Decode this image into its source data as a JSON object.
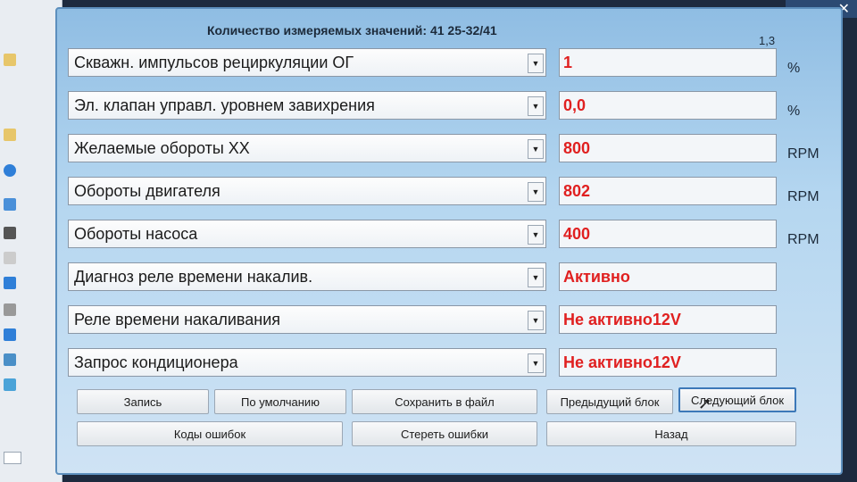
{
  "header": {
    "title": "Количество измеряемых значений: 41  25-32/41",
    "corner_value": "1,3"
  },
  "rows": [
    {
      "label": "Скважн. импульсов рециркуляции ОГ",
      "value": "1",
      "unit": "%"
    },
    {
      "label": "Эл. клапан управл. уровнем завихрения",
      "value": "0,0",
      "unit": "%"
    },
    {
      "label": "Желаемые обороты ХХ",
      "value": "800",
      "unit": "RPM"
    },
    {
      "label": "Обороты двигателя",
      "value": "802",
      "unit": "RPM"
    },
    {
      "label": "Обороты насоса",
      "value": "400",
      "unit": "RPM"
    },
    {
      "label": "Диагноз реле времени накалив.",
      "value": "Активно",
      "unit": ""
    },
    {
      "label": "Реле времени накаливания",
      "value": "Не активно12V",
      "unit": ""
    },
    {
      "label": "Запрос кондиционера",
      "value": "Не активно12V",
      "unit": ""
    }
  ],
  "buttons": {
    "record": "Запись",
    "defaults": "По умолчанию",
    "save_file": "Сохранить в файл",
    "prev_block": "Предыдущий блок",
    "next_block": "Следующий блок",
    "error_codes": "Коды ошибок",
    "clear_errors": "Стереть ошибки",
    "back": "Назад"
  },
  "colors": {
    "value_text": "#e02020",
    "dialog_bg": "#b4d6f0"
  }
}
